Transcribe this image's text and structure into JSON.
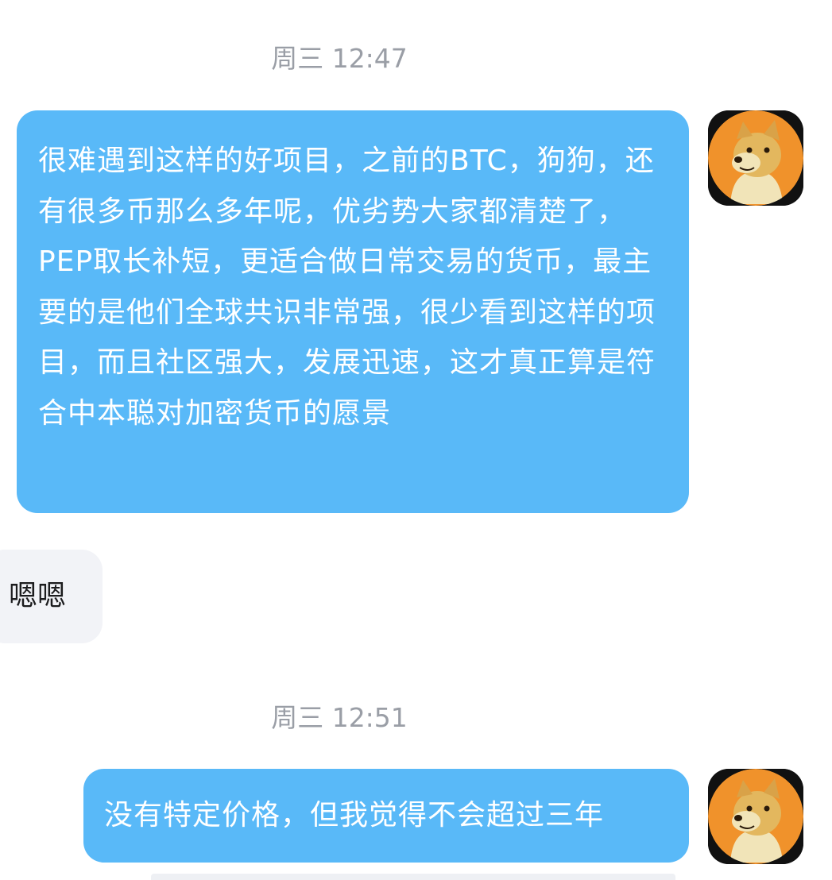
{
  "timestamps": [
    "周三 12:47",
    "周三 12:51"
  ],
  "messages": [
    {
      "direction": "outgoing",
      "text": "很难遇到这样的好项目，之前的BTC，狗狗，还有很多币那么多年呢，优劣势大家都清楚了，PEP取长补短，更适合做日常交易的货币，最主要的是他们全球共识非常强，很少看到这样的项目，而且社区强大，发展迅速，这才真正算是符合中本聪对加密货币的愿景",
      "avatar_icon": "doge-avatar-icon"
    },
    {
      "direction": "incoming",
      "text": "嗯嗯"
    },
    {
      "direction": "outgoing",
      "text": "没有特定价格，但我觉得不会超过三年",
      "avatar_icon": "doge-avatar-icon"
    }
  ],
  "colors": {
    "outgoing_bubble": "#59b9f8",
    "incoming_bubble": "#f2f3f7",
    "timestamp_text": "#9a9ea6",
    "avatar_bg": "#f0922b"
  }
}
